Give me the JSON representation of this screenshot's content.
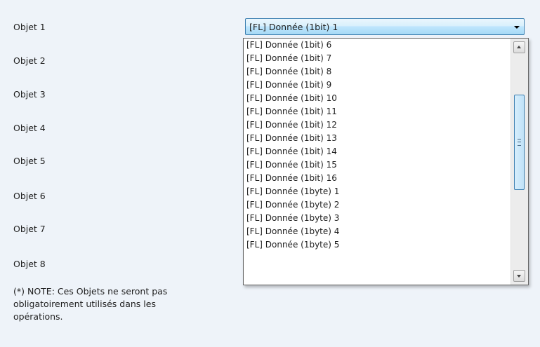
{
  "objects": [
    {
      "label": "Objet 1"
    },
    {
      "label": "Objet 2"
    },
    {
      "label": "Objet 3"
    },
    {
      "label": "Objet 4"
    },
    {
      "label": "Objet 5"
    },
    {
      "label": "Objet 6"
    },
    {
      "label": "Objet 7"
    },
    {
      "label": "Objet 8"
    }
  ],
  "combo": {
    "value": "[FL] Donnée (1bit) 1",
    "arrow_icon": "chevron-down-icon"
  },
  "dropdown": {
    "options": [
      "[FL] Donnée (1bit) 6",
      "[FL] Donnée (1bit) 7",
      "[FL] Donnée (1bit) 8",
      "[FL] Donnée (1bit) 9",
      "[FL] Donnée (1bit) 10",
      "[FL] Donnée (1bit) 11",
      "[FL] Donnée (1bit) 12",
      "[FL] Donnée (1bit) 13",
      "[FL] Donnée (1bit) 14",
      "[FL] Donnée (1bit) 15",
      "[FL] Donnée (1bit) 16",
      "[FL] Donnée (1byte) 1",
      "[FL] Donnée (1byte) 2",
      "[FL] Donnée (1byte) 3",
      "[FL] Donnée (1byte) 4",
      "[FL] Donnée (1byte) 5"
    ]
  },
  "note": {
    "line1": "(*) NOTE: Ces Objets ne seront pas",
    "line2": "obligatoirement utilisés dans les",
    "line3": "opérations."
  },
  "colors": {
    "background": "#eef3f9",
    "accent": "#3c7fb1"
  }
}
